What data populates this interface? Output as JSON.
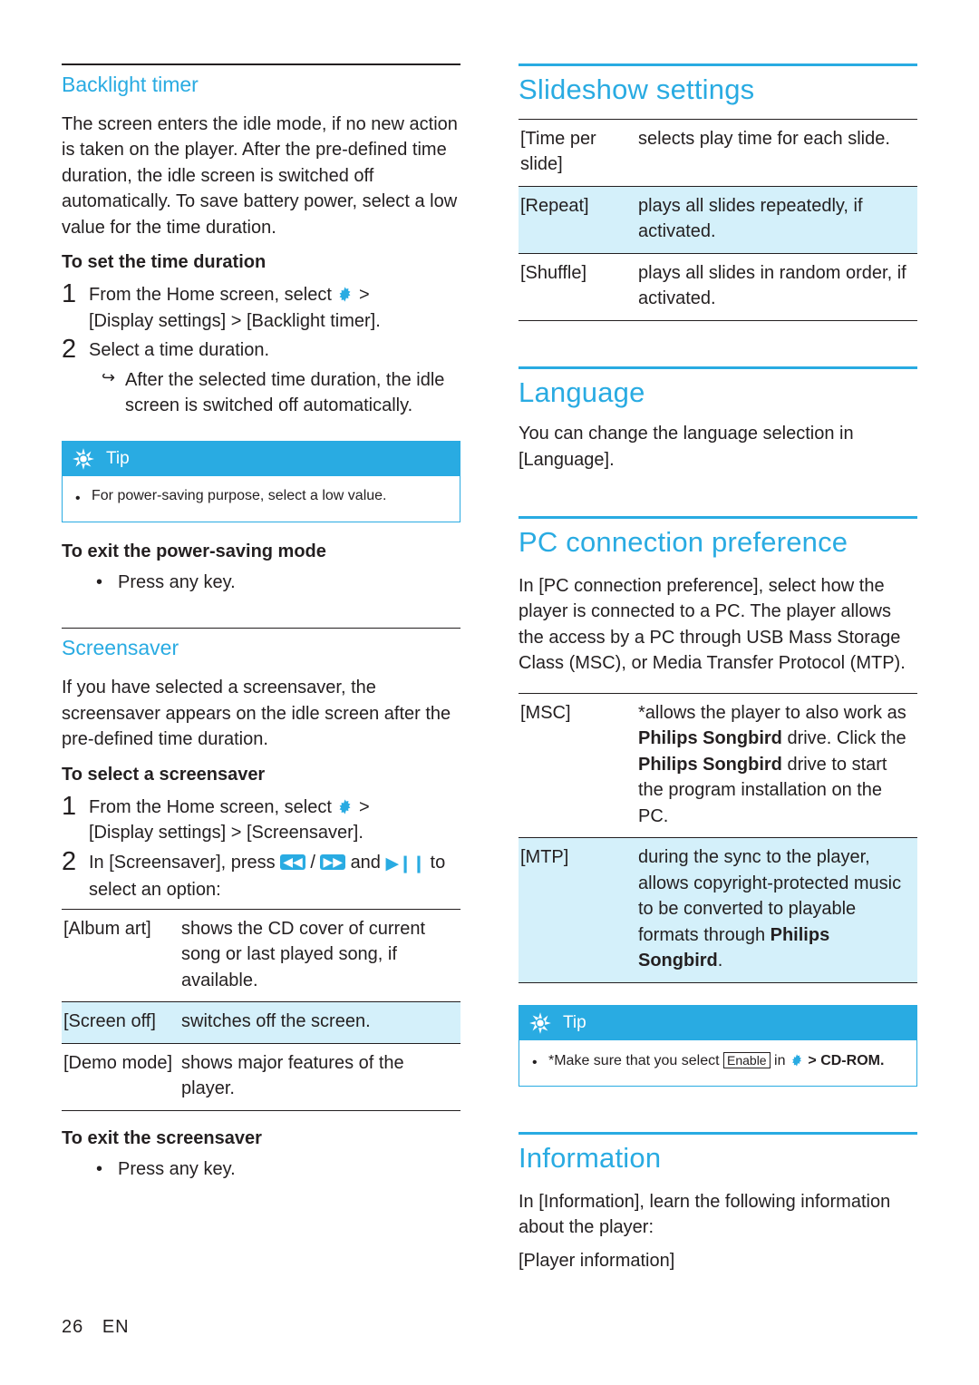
{
  "left_column": {
    "backlight": {
      "title": "Backlight timer",
      "paragraph": "The screen enters the idle mode, if no new action is taken on the player. After the pre-defined time duration, the idle screen is switched off automatically. To save battery power, select a low value for the time duration.",
      "howto_title": "To set the time duration",
      "step1_num": "1",
      "step1_line1": "From the Home screen, select",
      "step1_line2": "[Display settings] > [Backlight timer].",
      "step2_num": "2",
      "step2_text": "Select a time duration.",
      "substep_text": "After the selected time duration, the idle screen is switched off automatically."
    },
    "tip": {
      "label": "Tip",
      "text": "For power-saving purpose, select a low value."
    },
    "exit_power_saving": {
      "title": "To exit the power-saving mode",
      "bullet": "Press any key."
    },
    "screensaver": {
      "title": "Screensaver",
      "paragraph": "If you have selected a screensaver, the screensaver appears on the idle screen after the pre-defined time duration.",
      "howto_title": "To select a screensaver",
      "step1_num": "1",
      "step1_line1": "From the Home screen, select",
      "step1_line2": "[Display settings] > [Screensaver].",
      "step2_num": "2",
      "step2_pre": "In [Screensaver], press",
      "step2_mid": "and",
      "step2_post": "to",
      "step2_line2": "select an option:",
      "table": [
        {
          "key": "[Album art]",
          "value": "shows the CD cover of current song or last played song, if available.",
          "shaded": false
        },
        {
          "key": "[Screen off]",
          "value": "switches off the screen.",
          "shaded": true
        },
        {
          "key": "[Demo mode]",
          "value": "shows major features of the player.",
          "shaded": false
        }
      ],
      "exit_title": "To exit the screensaver",
      "exit_bullet": "Press any key."
    }
  },
  "right_column": {
    "slideshow": {
      "title": "Slideshow settings",
      "table": [
        {
          "key": "[Time per slide]",
          "value": "selects play time for each slide.",
          "shaded": false
        },
        {
          "key": "[Repeat]",
          "value": "plays all slides repeatedly, if activated.",
          "shaded": true
        },
        {
          "key": "[Shuffle]",
          "value": "plays all slides in random order, if activated.",
          "shaded": false
        }
      ]
    },
    "language": {
      "title": "Language",
      "paragraph": "You can change the language selection in [Language]."
    },
    "pc_connection": {
      "title": "PC connection preference",
      "paragraph": "In [PC connection preference], select how the player is connected to a PC. The player allows the access by a PC through USB Mass Storage Class (MSC), or Media Transfer Protocol (MTP).",
      "table": [
        {
          "key": "[MSC]",
          "value_parts": [
            {
              "text": "*allows the player to also work as ",
              "bold": false
            },
            {
              "text": "Philips Songbird",
              "bold": true
            },
            {
              "text": " drive. Click the ",
              "bold": false
            },
            {
              "text": "Philips Songbird",
              "bold": true
            },
            {
              "text": " drive to start the program installation on the PC.",
              "bold": false
            }
          ],
          "shaded": false
        },
        {
          "key": "[MTP]",
          "value_parts": [
            {
              "text": "during the sync to the player, allows copyright-protected music to be converted to playable formats through ",
              "bold": false
            },
            {
              "text": "Philips Songbird",
              "bold": true
            },
            {
              "text": ".",
              "bold": false
            }
          ],
          "shaded": true
        }
      ],
      "tip": {
        "label": "Tip",
        "text_pre": "*Make sure that you select",
        "enable_label": "Enable",
        "text_mid": "in",
        "text_post": "> CD-ROM."
      }
    },
    "information": {
      "title": "Information",
      "paragraph": "In [Information], learn the following information about the player:",
      "sub_item": "[Player information]"
    }
  },
  "footer": {
    "page_number": "26",
    "language_code": "EN"
  }
}
